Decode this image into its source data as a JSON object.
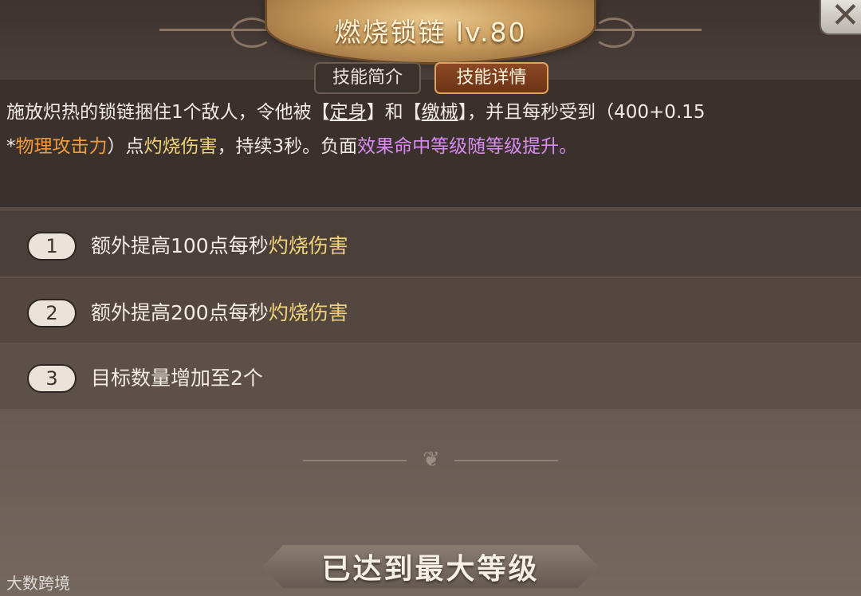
{
  "header": {
    "skill_title": "燃烧锁链 lv.80",
    "close_icon": "close-icon"
  },
  "tabs": [
    {
      "label": "技能简介",
      "active": false
    },
    {
      "label": "技能详情",
      "active": true
    }
  ],
  "description": {
    "t1": "施放炽热的锁链捆住1个敌人，令他被【",
    "t2": "定身",
    "t3": "】和【",
    "t4": "缴械",
    "t5": "】，并且每秒受到（400+0.15",
    "t6": "*",
    "t7": "物理攻击力",
    "t8": "）点",
    "t9": "灼烧伤害",
    "t10": "，持续3秒。负面",
    "t11": "效果命中等级随等级提升。"
  },
  "upgrades": [
    {
      "num": "1",
      "text": "额外提高100点每秒",
      "highlight": "灼烧伤害"
    },
    {
      "num": "2",
      "text": "额外提高200点每秒",
      "highlight": "灼烧伤害"
    },
    {
      "num": "3",
      "text": "目标数量增加至2个",
      "highlight": ""
    }
  ],
  "footer": {
    "status": "已达到最大等级",
    "watermark": "大数跨境"
  },
  "colors": {
    "orange": "#f39b3d",
    "yellow": "#f0d27a",
    "purple": "#d88bf0"
  }
}
